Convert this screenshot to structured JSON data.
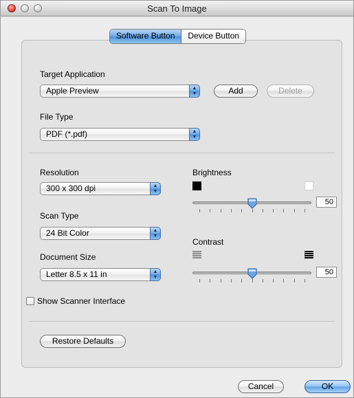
{
  "window": {
    "title": "Scan To Image"
  },
  "tabs": [
    {
      "label": "Software Button",
      "selected": true
    },
    {
      "label": "Device Button",
      "selected": false
    }
  ],
  "target_application": {
    "label": "Target Application",
    "value": "Apple Preview",
    "add_label": "Add",
    "delete_label": "Delete"
  },
  "file_type": {
    "label": "File Type",
    "value": "PDF (*.pdf)"
  },
  "resolution": {
    "label": "Resolution",
    "value": "300 x 300 dpi"
  },
  "scan_type": {
    "label": "Scan Type",
    "value": "24 Bit Color"
  },
  "document_size": {
    "label": "Document Size",
    "value": "Letter  8.5 x 11 in"
  },
  "show_scanner_interface": {
    "label": "Show Scanner Interface",
    "checked": false
  },
  "brightness": {
    "label": "Brightness",
    "value": "50",
    "level": 0.5
  },
  "contrast": {
    "label": "Contrast",
    "value": "50",
    "level": 0.5
  },
  "restore_defaults_label": "Restore Defaults",
  "cancel_label": "Cancel",
  "ok_label": "OK",
  "colors": {
    "accent": "#6aa7e6"
  }
}
